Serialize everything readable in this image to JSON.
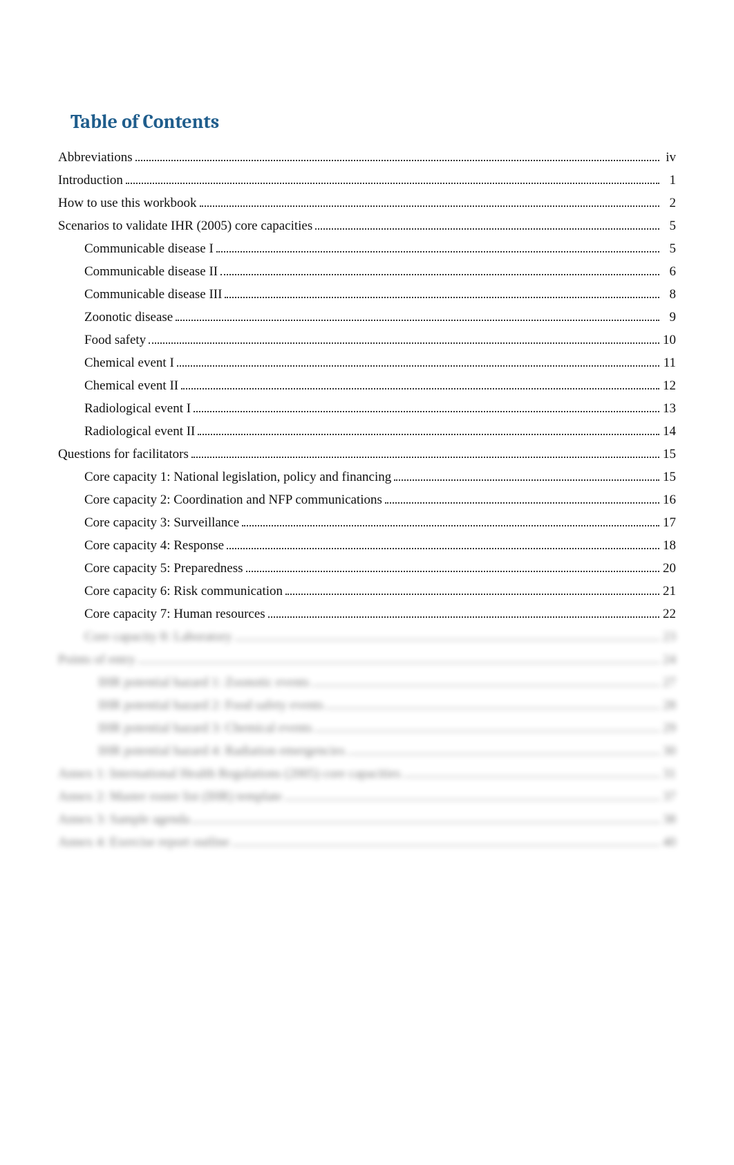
{
  "title": "Table of Contents",
  "toc": [
    {
      "level": 0,
      "label": "Abbreviations",
      "page": "iv",
      "blurred": false
    },
    {
      "level": 0,
      "label": "Introduction",
      "page": "1",
      "blurred": false
    },
    {
      "level": 0,
      "label": "How to use this workbook",
      "page": "2",
      "blurred": false
    },
    {
      "level": 0,
      "label": "Scenarios to validate IHR (2005) core capacities",
      "page": "5",
      "blurred": false
    },
    {
      "level": 1,
      "label": "Communicable disease I",
      "page": "5",
      "blurred": false
    },
    {
      "level": 1,
      "label": "Communicable disease II",
      "page": "6",
      "blurred": false
    },
    {
      "level": 1,
      "label": "Communicable disease III",
      "page": "8",
      "blurred": false
    },
    {
      "level": 1,
      "label": "Zoonotic disease",
      "page": "9",
      "blurred": false
    },
    {
      "level": 1,
      "label": "Food safety",
      "page": "10",
      "blurred": false
    },
    {
      "level": 1,
      "label": "Chemical event I",
      "page": "11",
      "blurred": false
    },
    {
      "level": 1,
      "label": "Chemical event II",
      "page": "12",
      "blurred": false
    },
    {
      "level": 1,
      "label": "Radiological event I",
      "page": "13",
      "blurred": false
    },
    {
      "level": 1,
      "label": "Radiological event II",
      "page": "14",
      "blurred": false
    },
    {
      "level": 0,
      "label": "Questions for facilitators",
      "page": "15",
      "blurred": false
    },
    {
      "level": 1,
      "label": "Core capacity 1: National legislation, policy and financing",
      "page": "15",
      "blurred": false
    },
    {
      "level": 1,
      "label": "Core capacity 2: Coordination and NFP communications",
      "page": "16",
      "blurred": false
    },
    {
      "level": 1,
      "label": "Core capacity 3: Surveillance",
      "page": "17",
      "blurred": false
    },
    {
      "level": 1,
      "label": "Core capacity 4: Response",
      "page": "18",
      "blurred": false
    },
    {
      "level": 1,
      "label": "Core capacity 5: Preparedness",
      "page": "20",
      "blurred": false
    },
    {
      "level": 1,
      "label": "Core capacity 6: Risk communication",
      "page": "21",
      "blurred": false
    },
    {
      "level": 1,
      "label": "Core capacity 7: Human resources",
      "page": "22",
      "blurred": false
    },
    {
      "level": 1,
      "label": "Core capacity 8: Laboratory",
      "page": "23",
      "blurred": true
    },
    {
      "level": 0,
      "label": "Points of entry",
      "page": "24",
      "blurred": true
    },
    {
      "level": 2,
      "label": "IHR potential hazard 1: Zoonotic events",
      "page": "27",
      "blurred": true
    },
    {
      "level": 2,
      "label": "IHR potential hazard 2: Food safety events",
      "page": "28",
      "blurred": true
    },
    {
      "level": 2,
      "label": "IHR potential hazard 3: Chemical events",
      "page": "29",
      "blurred": true
    },
    {
      "level": 2,
      "label": "IHR potential hazard 4: Radiation emergencies",
      "page": "30",
      "blurred": true
    },
    {
      "level": 0,
      "label": "Annex 1: International Health Regulations (2005) core capacities",
      "page": "31",
      "blurred": true
    },
    {
      "level": 0,
      "label": "Annex 2: Master roster list (IHR) template",
      "page": "37",
      "blurred": true
    },
    {
      "level": 0,
      "label": "Annex 3: Sample agenda",
      "page": "38",
      "blurred": true
    },
    {
      "level": 0,
      "label": "Annex 4: Exercise report outline",
      "page": "40",
      "blurred": true
    }
  ]
}
